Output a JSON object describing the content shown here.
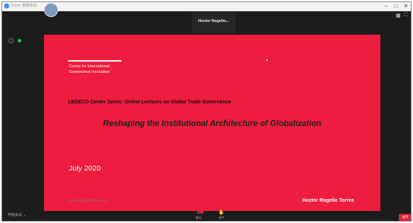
{
  "window": {
    "title": "Zoom 视频会议",
    "controls": {
      "minimize": "–",
      "maximize": "□",
      "close": "✕"
    }
  },
  "top_bar": {
    "participant_name": "Hector Rogelio...",
    "icons": [
      "layout-icon",
      "fullscreen-icon"
    ]
  },
  "slide": {
    "background_color": "#ee1c3e",
    "logo_line1": "Centre for International",
    "logo_line2": "Governance Innovation",
    "subtitle": "LEDECO Center Swiss: Online Lectures on Global Trade Governance",
    "title": "Reshaping the Institutional Architecture of Globalization",
    "date": "July 2020",
    "url": "www.cigionline.org",
    "author": "Hector Rogelio Torres"
  },
  "bottom_bar": {
    "left_label": "开始会议 ⌄",
    "tools": [
      {
        "glyph": "☺",
        "label": "聊天"
      },
      {
        "glyph": "✋",
        "label": "举手"
      }
    ],
    "end_button": "离开"
  },
  "colors": {
    "window_bg": "#1c1c1c",
    "slide_red": "#ee1c3e",
    "end_red": "#e0243b",
    "status_green": "#1fbf4f"
  }
}
